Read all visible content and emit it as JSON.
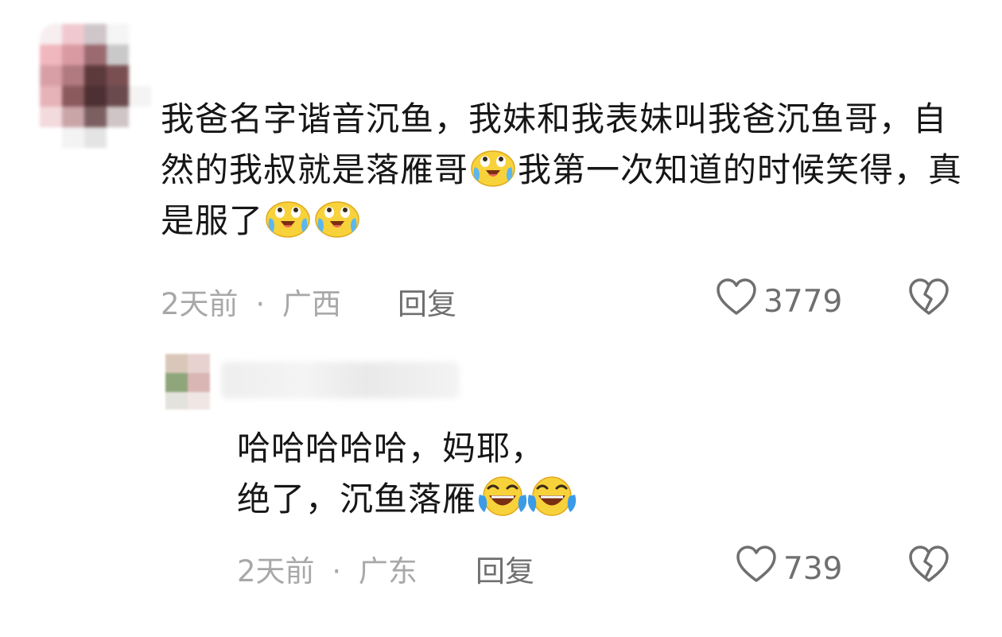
{
  "comment": {
    "text_part1": "我爸名字谐音沉鱼，我妹和我表妹叫我爸沉鱼哥，自然的我叔就是落雁哥",
    "text_part2": "我第一次知道的时候笑得，真是服了",
    "emoji_names": [
      "crying-face-emoji",
      "crying-face-emoji",
      "crying-face-emoji"
    ],
    "time": "2天前",
    "separator": "·",
    "location": "广西",
    "reply_label": "回复",
    "likes": "3779"
  },
  "reply": {
    "text_line1": "哈哈哈哈哈，妈耶，",
    "text_line2": "绝了，沉鱼落雁",
    "emoji_names": [
      "laughing-tears-emoji",
      "laughing-tears-emoji"
    ],
    "time": "2天前",
    "separator": "·",
    "location": "广东",
    "reply_label": "回复",
    "likes": "739"
  },
  "colors": {
    "text": "#161616",
    "meta": "#a8a8a8",
    "action": "#6f6f6f"
  }
}
